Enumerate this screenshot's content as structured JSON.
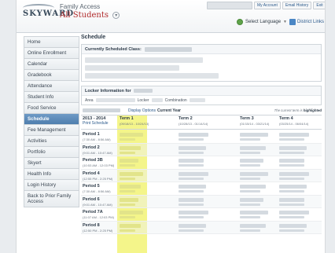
{
  "header": {
    "logo": "SKYWARD",
    "app_title": "Family Access",
    "student_selector": "All Students",
    "links": [
      "My Account",
      "Email History",
      "Exit"
    ],
    "language": "Select Language",
    "district_links": "District Links",
    "colors": {
      "accent": "#4f7fae",
      "brand_red": "#b0282a",
      "highlight": "#f4f58a"
    }
  },
  "sidebar": {
    "items": [
      {
        "label": "Home"
      },
      {
        "label": "Online Enrollment"
      },
      {
        "label": "Calendar"
      },
      {
        "label": "Gradebook"
      },
      {
        "label": "Attendance"
      },
      {
        "label": "Student Info"
      },
      {
        "label": "Food Service"
      },
      {
        "label": "Schedule",
        "active": true
      },
      {
        "label": "Fee Management"
      },
      {
        "label": "Activities"
      },
      {
        "label": "Portfolio"
      },
      {
        "label": "Skyert"
      },
      {
        "label": "Health Info"
      },
      {
        "label": "Login History"
      },
      {
        "label": "Back to Prior Family Access"
      }
    ]
  },
  "main": {
    "title": "Schedule",
    "current_class_label": "Currently Scheduled Class:",
    "locker_label": "Locker Information for",
    "locker_area": "Area",
    "locker_locker": "Locker",
    "locker_combination": "Combination",
    "display_options": "Display Options",
    "current_year": "Current Year",
    "highlight_note_pre": "The current term is",
    "highlight_note_bold": "highlighted",
    "year": "2013 - 2014",
    "print": "Print Schedule",
    "terms": [
      {
        "name": "Term 1",
        "dates": "(09/18/13 - 10/24/13)"
      },
      {
        "name": "Term 2",
        "dates": "(10/28/13 - 01/14/14)"
      },
      {
        "name": "Term 3",
        "dates": "(01/15/14 - 03/21/14)"
      },
      {
        "name": "Term 4",
        "dates": "(03/25/14 - 06/04/14)"
      }
    ],
    "periods": [
      {
        "name": "Period 1",
        "time": "(7:30 AM - 8:56 AM)"
      },
      {
        "name": "Period 2",
        "time": "(9:01 AM - 10:47 AM)"
      },
      {
        "name": "Period 3B",
        "time": "(10:53 AM - 12:03 PM)"
      },
      {
        "name": "Period 4",
        "time": "(12:55 PM - 2:25 PM)"
      },
      {
        "name": "Period 5",
        "time": "(7:30 AM - 8:56 AM)"
      },
      {
        "name": "Period 6",
        "time": "(9:01 AM - 10:47 AM)"
      },
      {
        "name": "Period 7A",
        "time": "(11:07 AM - 12:03 PM)"
      },
      {
        "name": "Period 8",
        "time": "(12:50 PM - 2:25 PM)"
      }
    ]
  }
}
